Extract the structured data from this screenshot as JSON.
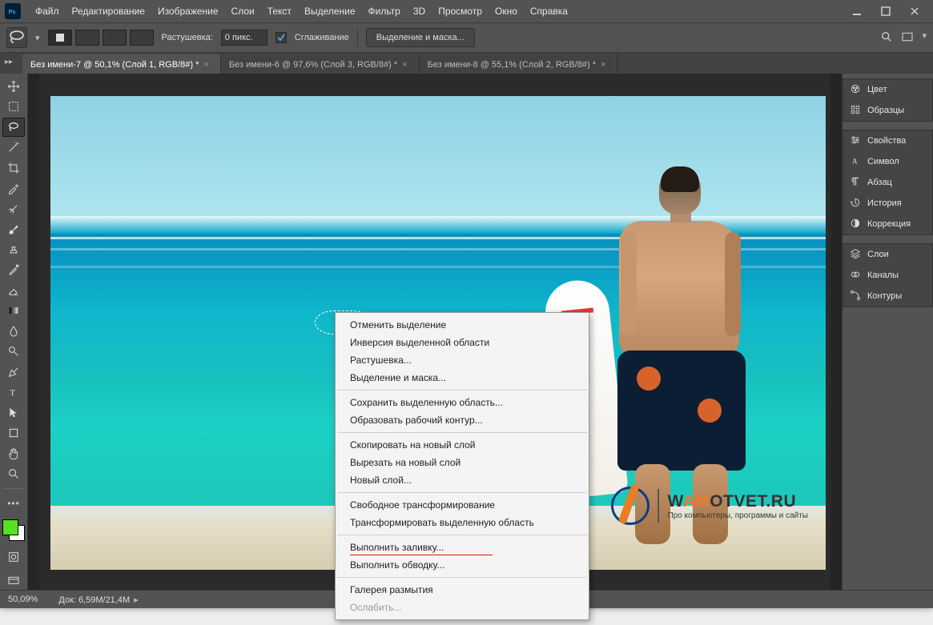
{
  "menubar": {
    "items": [
      "Файл",
      "Редактирование",
      "Изображение",
      "Слои",
      "Текст",
      "Выделение",
      "Фильтр",
      "3D",
      "Просмотр",
      "Окно",
      "Справка"
    ]
  },
  "options": {
    "feather_label": "Растушевка:",
    "feather_value": "0 пикс.",
    "antialias_label": "Сглаживание",
    "refine_btn": "Выделение и маска..."
  },
  "tabs": [
    {
      "label": "Без имени-7 @ 50,1% (Слой 1, RGB/8#) *",
      "active": true
    },
    {
      "label": "Без имени-6 @ 97,6% (Слой 3, RGB/8#) *",
      "active": false
    },
    {
      "label": "Без имени-8 @ 55,1% (Слой 2, RGB/8#) *",
      "active": false
    }
  ],
  "panels": {
    "group1": [
      "Цвет",
      "Образцы"
    ],
    "group2": [
      "Свойства",
      "Символ",
      "Абзац",
      "История",
      "Коррекция"
    ],
    "group3": [
      "Слои",
      "Каналы",
      "Контуры"
    ]
  },
  "context_menu": {
    "items": [
      {
        "t": "Отменить выделение"
      },
      {
        "t": "Инверсия выделенной области"
      },
      {
        "t": "Растушевка..."
      },
      {
        "t": "Выделение и маска..."
      },
      {
        "sep": true
      },
      {
        "t": "Сохранить выделенную область..."
      },
      {
        "t": "Образовать рабочий контур..."
      },
      {
        "sep": true
      },
      {
        "t": "Скопировать на новый слой"
      },
      {
        "t": "Вырезать на новый слой"
      },
      {
        "t": "Новый слой..."
      },
      {
        "sep": true
      },
      {
        "t": "Свободное трансформирование"
      },
      {
        "t": "Трансформировать выделенную область"
      },
      {
        "sep": true
      },
      {
        "t": "Выполнить заливку...",
        "hl": true
      },
      {
        "t": "Выполнить обводку..."
      },
      {
        "sep": true
      },
      {
        "t": "Галерея размытия"
      },
      {
        "t": "Ослабить...",
        "d": true
      }
    ]
  },
  "status": {
    "zoom": "50,09%",
    "doc_label": "Док:",
    "doc_size": "6,59M/21,4M"
  },
  "watermark": {
    "prefix": "W",
    "orange": "AM",
    "rest": "OTVET.RU",
    "sub": "Про компьютеры, программы и сайты"
  },
  "colors": {
    "fg": "#57e024",
    "bg": "#ffffff"
  }
}
